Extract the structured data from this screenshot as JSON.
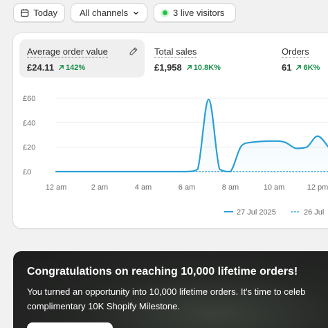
{
  "filters": {
    "today_label": "Today",
    "channels_label": "All channels",
    "visitors_label": "3 live visitors"
  },
  "metrics": [
    {
      "label": "Average order value",
      "value": "£24.11",
      "change": "142%",
      "active": true
    },
    {
      "label": "Total sales",
      "value": "£1,958",
      "change": "10.8K%",
      "active": false
    },
    {
      "label": "Orders",
      "value": "61",
      "change": "6K%",
      "active": false
    }
  ],
  "chart_data": {
    "type": "line",
    "x": [
      "12 am",
      "1 am",
      "2 am",
      "3 am",
      "4 am",
      "5 am",
      "6 am",
      "6:30 am",
      "7 am",
      "7:30 am",
      "8 am",
      "8:30 am",
      "9 am",
      "10 am",
      "10:30 am",
      "11 am",
      "11:30 am",
      "12 pm",
      "12:30 pm"
    ],
    "x_hours": [
      0,
      1,
      2,
      3,
      4,
      5,
      6,
      6.5,
      7,
      7.5,
      8,
      8.5,
      9,
      10,
      10.5,
      11,
      11.5,
      12,
      12.5
    ],
    "series": [
      {
        "name": "27 Jul 2025",
        "values": [
          0,
          0,
          0,
          0,
          0,
          0,
          0,
          2,
          59,
          2,
          0,
          21,
          24,
          25,
          24,
          19,
          20,
          29,
          20
        ],
        "color": "#2a9fd6",
        "style": "solid"
      },
      {
        "name": "26 Jul",
        "values": [
          0,
          0,
          0,
          0,
          0,
          0,
          0,
          0,
          0,
          0,
          0,
          0,
          0,
          0,
          0,
          0,
          0,
          0,
          0
        ],
        "color": "#2a9fd6",
        "style": "dotted"
      }
    ],
    "x_ticks": [
      "12 am",
      "2 am",
      "4 am",
      "6 am",
      "8 am",
      "10 am",
      "12 pm"
    ],
    "x_tick_hours": [
      0,
      2,
      4,
      6,
      8,
      10,
      12
    ],
    "y_ticks": [
      "£0",
      "£20",
      "£40",
      "£60"
    ],
    "y_tick_values": [
      0,
      20,
      40,
      60
    ],
    "ylim": [
      0,
      60
    ],
    "grid": true,
    "legend_position": "bottom-right"
  },
  "banner": {
    "title": "Congratulations on reaching 10,000 lifetime orders!",
    "line1": "You turned an opportunity into 10,000 lifetime orders. It's time to celeb",
    "line2": "complimentary 10K Shopify Milestone."
  },
  "colors": {
    "accent": "#2a9fd6",
    "positive": "#1a8f4b",
    "live": "#26c145"
  }
}
